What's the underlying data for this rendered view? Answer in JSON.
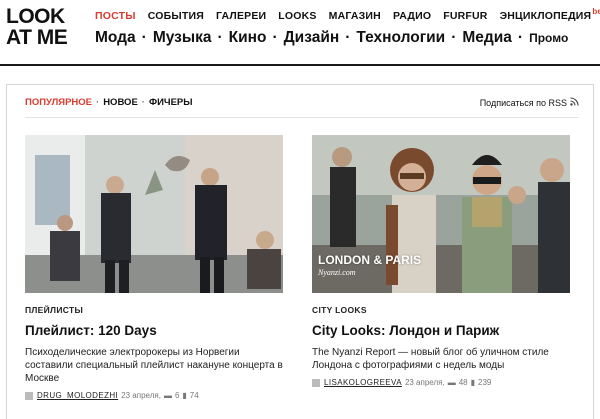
{
  "logo": {
    "line1": "LOOK",
    "line2": "AT ME"
  },
  "top_nav": [
    {
      "label": "ПОСТЫ",
      "active": true
    },
    {
      "label": "СОБЫТИЯ"
    },
    {
      "label": "ГАЛЕРЕИ"
    },
    {
      "label": "LOOKS"
    },
    {
      "label": "МАГАЗИН"
    },
    {
      "label": "РАДИО"
    },
    {
      "label": "FURFUR"
    },
    {
      "label": "ЭНЦИКЛОПЕДИЯ",
      "badge": "beta"
    }
  ],
  "main_nav": {
    "items": [
      "Мода",
      "Музыка",
      "Кино",
      "Дизайн",
      "Технологии",
      "Медиа",
      "Промо"
    ],
    "separator": "·"
  },
  "filters": {
    "items": [
      "ПОПУЛЯРНОЕ",
      "НОВОЕ",
      "ФИЧЕРЫ"
    ],
    "separator": "·",
    "active_color": "#d93b2e"
  },
  "rss": {
    "label": "Подписаться по RSS",
    "icon": "rss-icon"
  },
  "posts": [
    {
      "category": "ПЛЕЙЛИСТЫ",
      "title": "Плейлист: 120 Days",
      "description": "Психоделические электророкеры из Норвегии составили специальный плейлист накануне концерта в Москве",
      "author": "DRUG_MOLODEZHI",
      "date": "23 апреля,",
      "comments": "6",
      "likes": "74"
    },
    {
      "category": "CITY LOOKS",
      "title": "City Looks: Лондон и Париж",
      "description": "The Nyanzi Report — новый блог об уличном стиле Лондона с фотографиями с недель моды",
      "author": "LISAKOLOGREEVA",
      "date": "23 апреля,",
      "comments": "48",
      "likes": "239",
      "image_caption": "LONDON & PARIS",
      "image_subcaption": "Nyanzi.com"
    }
  ],
  "colors": {
    "accent": "#d93b2e",
    "text": "#111111",
    "muted": "#777777"
  }
}
